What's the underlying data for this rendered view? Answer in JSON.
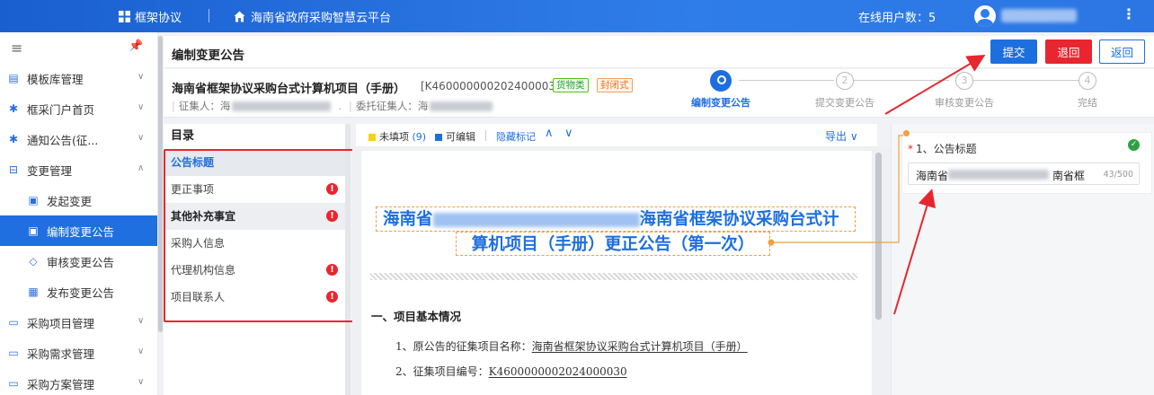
{
  "topbar": {
    "app_label": "框架协议",
    "platform_label": "海南省政府采购智慧云平台",
    "online_users": "在线用户数：5",
    "more_icon": "⋮"
  },
  "sidebar": {
    "items": [
      {
        "label": "模板库管理",
        "icon": "template-icon",
        "sub": false,
        "active": false,
        "chevron": "∨"
      },
      {
        "label": "框采门户首页",
        "icon": "grid-icon",
        "sub": false,
        "active": false,
        "chevron": "∨"
      },
      {
        "label": "通知公告(征...",
        "icon": "grid-icon",
        "sub": false,
        "active": false,
        "chevron": "∨"
      },
      {
        "label": "变更管理",
        "icon": "change-icon",
        "sub": false,
        "active": false,
        "chevron": "∧"
      },
      {
        "label": "发起变更",
        "icon": "doc-edit-icon",
        "sub": true,
        "active": false,
        "chevron": ""
      },
      {
        "label": "编制变更公告",
        "icon": "doc-edit-icon",
        "sub": true,
        "active": true,
        "chevron": ""
      },
      {
        "label": "审核变更公告",
        "icon": "diamond-icon",
        "sub": true,
        "active": false,
        "chevron": ""
      },
      {
        "label": "发布变更公告",
        "icon": "doc-list-icon",
        "sub": true,
        "active": false,
        "chevron": ""
      },
      {
        "label": "采购项目管理",
        "icon": "folder-icon",
        "sub": false,
        "active": false,
        "chevron": "∨"
      },
      {
        "label": "采购需求管理",
        "icon": "folder-icon",
        "sub": false,
        "active": false,
        "chevron": "∨"
      },
      {
        "label": "采购方案管理",
        "icon": "folder-icon",
        "sub": false,
        "active": false,
        "chevron": "∨"
      }
    ]
  },
  "main": {
    "title": "编制变更公告",
    "buttons": {
      "submit": "提交",
      "back": "退回",
      "return": "返回"
    }
  },
  "project": {
    "name": "海南省框架协议采购台式计算机项目（手册）",
    "code": "[K4600000002024000030]",
    "tag_goods": "货物类",
    "tag_closed": "封闭式",
    "collector_label": "征集人：",
    "collector_prefix": "海",
    "entrust_label": "委托征集人：",
    "entrust_prefix": "海"
  },
  "steps": [
    {
      "num": "1",
      "label": "编制变更公告",
      "current": true
    },
    {
      "num": "2",
      "label": "提交变更公告",
      "current": false
    },
    {
      "num": "3",
      "label": "审核变更公告",
      "current": false
    },
    {
      "num": "4",
      "label": "完结",
      "current": false
    }
  ],
  "toc": {
    "title": "目录",
    "items": [
      {
        "label": "公告标题",
        "kind": "sel",
        "warn": false
      },
      {
        "label": "更正事项",
        "kind": "normal",
        "warn": true
      },
      {
        "label": "其他补充事宜",
        "kind": "group",
        "warn": true
      },
      {
        "label": "采购人信息",
        "kind": "normal",
        "warn": false
      },
      {
        "label": "代理机构信息",
        "kind": "normal",
        "warn": true
      },
      {
        "label": "项目联系人",
        "kind": "normal",
        "warn": true
      }
    ],
    "warn_symbol": "!"
  },
  "doc": {
    "toolbar": {
      "unfilled": "未填项",
      "unfilled_count": "(9)",
      "editable": "可编辑",
      "hide_marks": "隐藏标记",
      "up": "∧",
      "down": "∨",
      "export": "导出 ∨"
    },
    "title_line1_prefix": "海南省",
    "title_line1_suffix": "海南省框架协议采购台式计",
    "title_line2": "算机项目（手册）更正公告（第一次）",
    "section1": "一、项目基本情况",
    "line1_label": "1、原公告的征集项目名称：",
    "line1_value": "海南省框架协议采购台式计算机项目（手册）",
    "line2_label": "2、征集项目编号：",
    "line2_value": "K4600000002024000030"
  },
  "rpanel": {
    "field_label": "1、公告标题",
    "required_mark": "*",
    "value_start": "海南省",
    "value_end": "南省框",
    "counter": "43/500",
    "ok_symbol": "✓"
  },
  "colors": {
    "primary": "#1d6fe0",
    "danger": "#e8262f",
    "annotation": "#e8262f",
    "connector": "#f0a040"
  }
}
